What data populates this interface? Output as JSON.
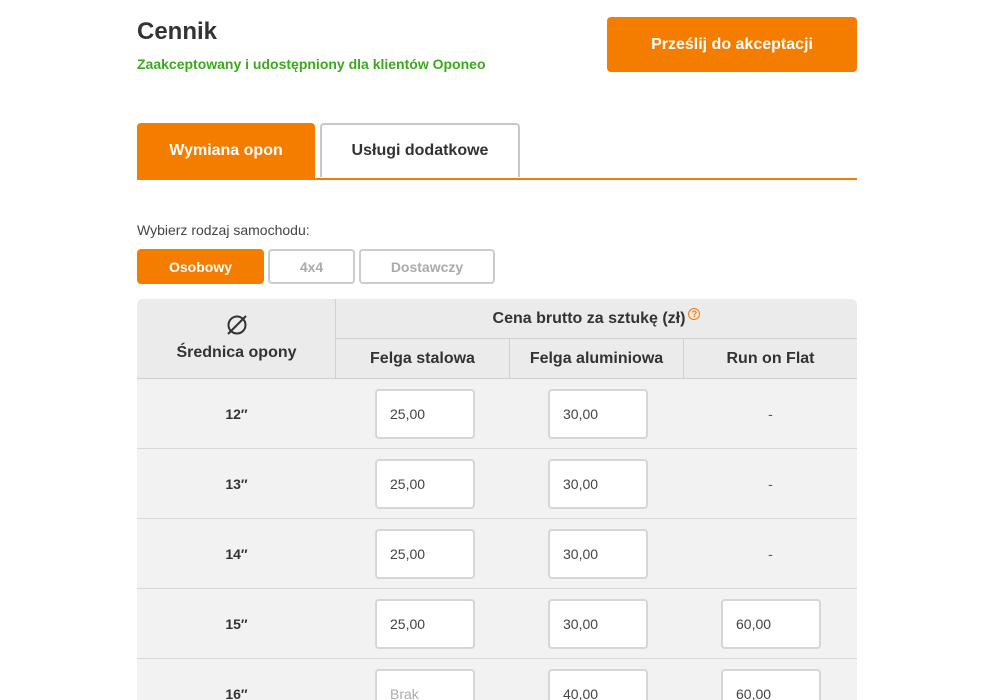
{
  "header": {
    "title": "Cennik",
    "status": "Zaakceptowany i udostępniony dla klientów Oponeo",
    "submit_label": "Prześlij do akceptacji"
  },
  "tabs": [
    {
      "label": "Wymiana opon",
      "active": true
    },
    {
      "label": "Usługi dodatkowe",
      "active": false
    }
  ],
  "car_type": {
    "label": "Wybierz rodzaj samochodu:",
    "options": [
      {
        "label": "Osobowy",
        "active": true
      },
      {
        "label": "4x4",
        "active": false
      },
      {
        "label": "Dostawczy",
        "active": false
      }
    ]
  },
  "table": {
    "diameter_icon": "diameter-icon",
    "diameter_header": "Średnica opony",
    "group_header": "Cena brutto za sztukę (zł)",
    "help_icon": "?",
    "columns": [
      "Felga stalowa",
      "Felga aluminiowa",
      "Run on Flat"
    ],
    "rows": [
      {
        "size": "12″",
        "steel": "25,00",
        "alu": "30,00",
        "rof": "-"
      },
      {
        "size": "13″",
        "steel": "25,00",
        "alu": "30,00",
        "rof": "-"
      },
      {
        "size": "14″",
        "steel": "25,00",
        "alu": "30,00",
        "rof": "-"
      },
      {
        "size": "15″",
        "steel": "25,00",
        "alu": "30,00",
        "rof": "60,00"
      },
      {
        "size": "16″",
        "steel": "",
        "steel_placeholder": "Brak",
        "alu": "40,00",
        "rof": "60,00"
      }
    ]
  },
  "colors": {
    "accent": "#f47d00",
    "success": "#3aaa1c"
  }
}
